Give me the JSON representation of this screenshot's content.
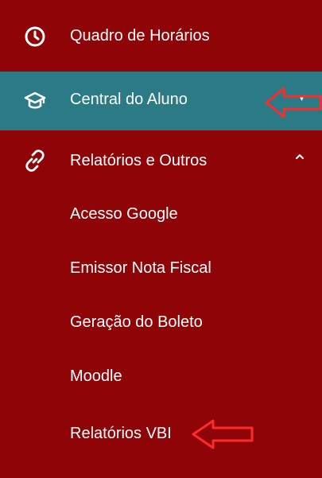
{
  "colors": {
    "sidebar_bg": "#8f0406",
    "active_bg": "#2a7b86",
    "text": "#ffffff",
    "annotation_arrow": "#ff2a2a"
  },
  "menu": {
    "items": [
      {
        "label": "Quadro de Horários",
        "icon": "clock-icon"
      },
      {
        "label": "Central do Aluno",
        "icon": "graduation-cap-icon",
        "active": true
      },
      {
        "label": "Relatórios e Outros",
        "icon": "link-icon",
        "expanded": true
      }
    ],
    "submenu": [
      {
        "label": "Acesso Google"
      },
      {
        "label": "Emissor Nota Fiscal"
      },
      {
        "label": "Geração do Boleto"
      },
      {
        "label": "Moodle"
      },
      {
        "label": "Relatórios VBI"
      }
    ]
  }
}
